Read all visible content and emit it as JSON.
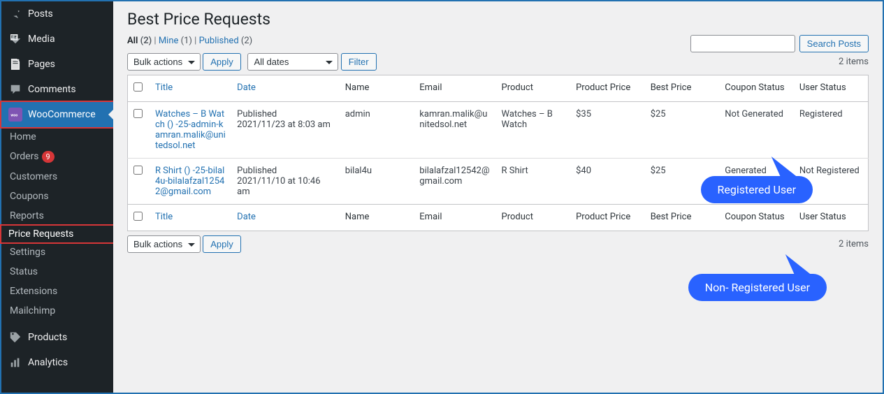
{
  "sidebar": {
    "items_top": [
      {
        "label": "Posts",
        "icon": "pin"
      },
      {
        "label": "Media",
        "icon": "media"
      },
      {
        "label": "Pages",
        "icon": "page"
      },
      {
        "label": "Comments",
        "icon": "comment"
      }
    ],
    "woocommerce_label": "WooCommerce",
    "sub_items": [
      {
        "label": "Home"
      },
      {
        "label": "Orders",
        "badge": "9"
      },
      {
        "label": "Customers"
      },
      {
        "label": "Coupons"
      },
      {
        "label": "Reports"
      },
      {
        "label": "Price Requests",
        "highlight": true
      },
      {
        "label": "Settings"
      },
      {
        "label": "Status"
      },
      {
        "label": "Extensions"
      },
      {
        "label": "Mailchimp"
      }
    ],
    "items_bottom": [
      {
        "label": "Products",
        "icon": "products"
      },
      {
        "label": "Analytics",
        "icon": "analytics"
      }
    ]
  },
  "page": {
    "title": "Best Price Requests",
    "filters": {
      "all_label": "All",
      "all_count": "(2)",
      "mine_label": "Mine",
      "mine_count": "(1)",
      "published_label": "Published",
      "published_count": "(2)"
    },
    "bulk_label": "Bulk actions",
    "apply_label": "Apply",
    "dates_label": "All dates",
    "filter_label": "Filter",
    "items_count": "2 items",
    "search_btn": "Search Posts"
  },
  "table": {
    "headers": {
      "title": "Title",
      "date": "Date",
      "name": "Name",
      "email": "Email",
      "product": "Product",
      "product_price": "Product Price",
      "best_price": "Best Price",
      "coupon": "Coupon Status",
      "user": "User Status"
    },
    "rows": [
      {
        "title": "Watches – B Watch () -25-admin-kamran.malik@unitedsol.net",
        "date_status": "Published",
        "date_time": "2021/11/23 at 8:03 am",
        "name": "admin",
        "email": "kamran.malik@unitedsol.net",
        "product": "Watches – B Watch",
        "product_price": "$35",
        "best_price": "$25",
        "coupon": "Not Generated",
        "user": "Registered"
      },
      {
        "title": "R Shirt () -25-bilal4u-bilalafzal12542@gmail.com",
        "date_status": "Published",
        "date_time": "2021/11/10 at 10:46 am",
        "name": "bilal4u",
        "email": "bilalafzal12542@gmail.com",
        "product": "R Shirt",
        "product_price": "$40",
        "best_price": "$25",
        "coupon": "Generated",
        "user": "Not Registered"
      }
    ]
  },
  "callouts": {
    "registered": "Registered User",
    "non_registered": "Non- Registered User"
  }
}
